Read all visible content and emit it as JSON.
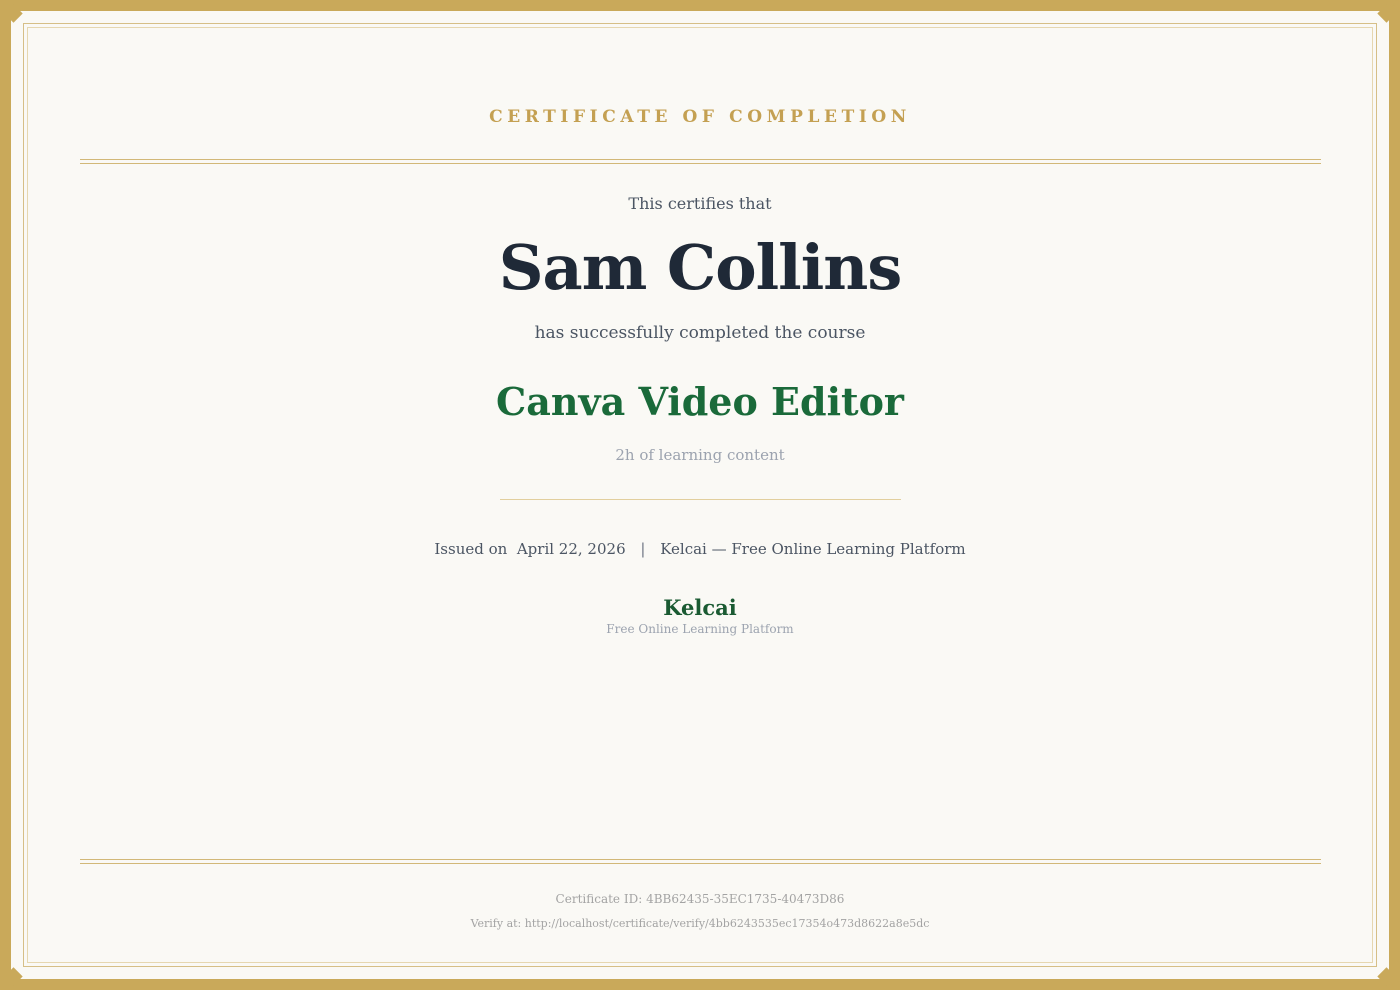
{
  "certificate": {
    "heading": "CERTIFICATE OF COMPLETION",
    "certifies_text": "This certifies that",
    "recipient_name": "Sam Collins",
    "completed_text": "has successfully completed the course",
    "course_title": "Canva Video Editor",
    "duration_text": "2h of learning content",
    "issued_label": "Issued on",
    "issued_date": "April 22, 2026",
    "separator": "|",
    "issuer_line": "Kelcai — Free Online Learning Platform",
    "brand_name": "Kelcai",
    "brand_tagline": "Free Online Learning Platform",
    "certificate_id": "Certificate ID: 4BB62435-35EC1735-40473D86",
    "verify_text": "Verify at: http://localhost/certificate/verify/4bb6243535ec17354o473d8622a8e5dc"
  },
  "colors": {
    "frame_gold": "#c9a95a",
    "heading_gold": "#c4a052",
    "recipient_dark": "#1f2937",
    "course_green": "#1a6a3a",
    "brand_green": "#1a5a32",
    "paper": "#faf9f5"
  }
}
